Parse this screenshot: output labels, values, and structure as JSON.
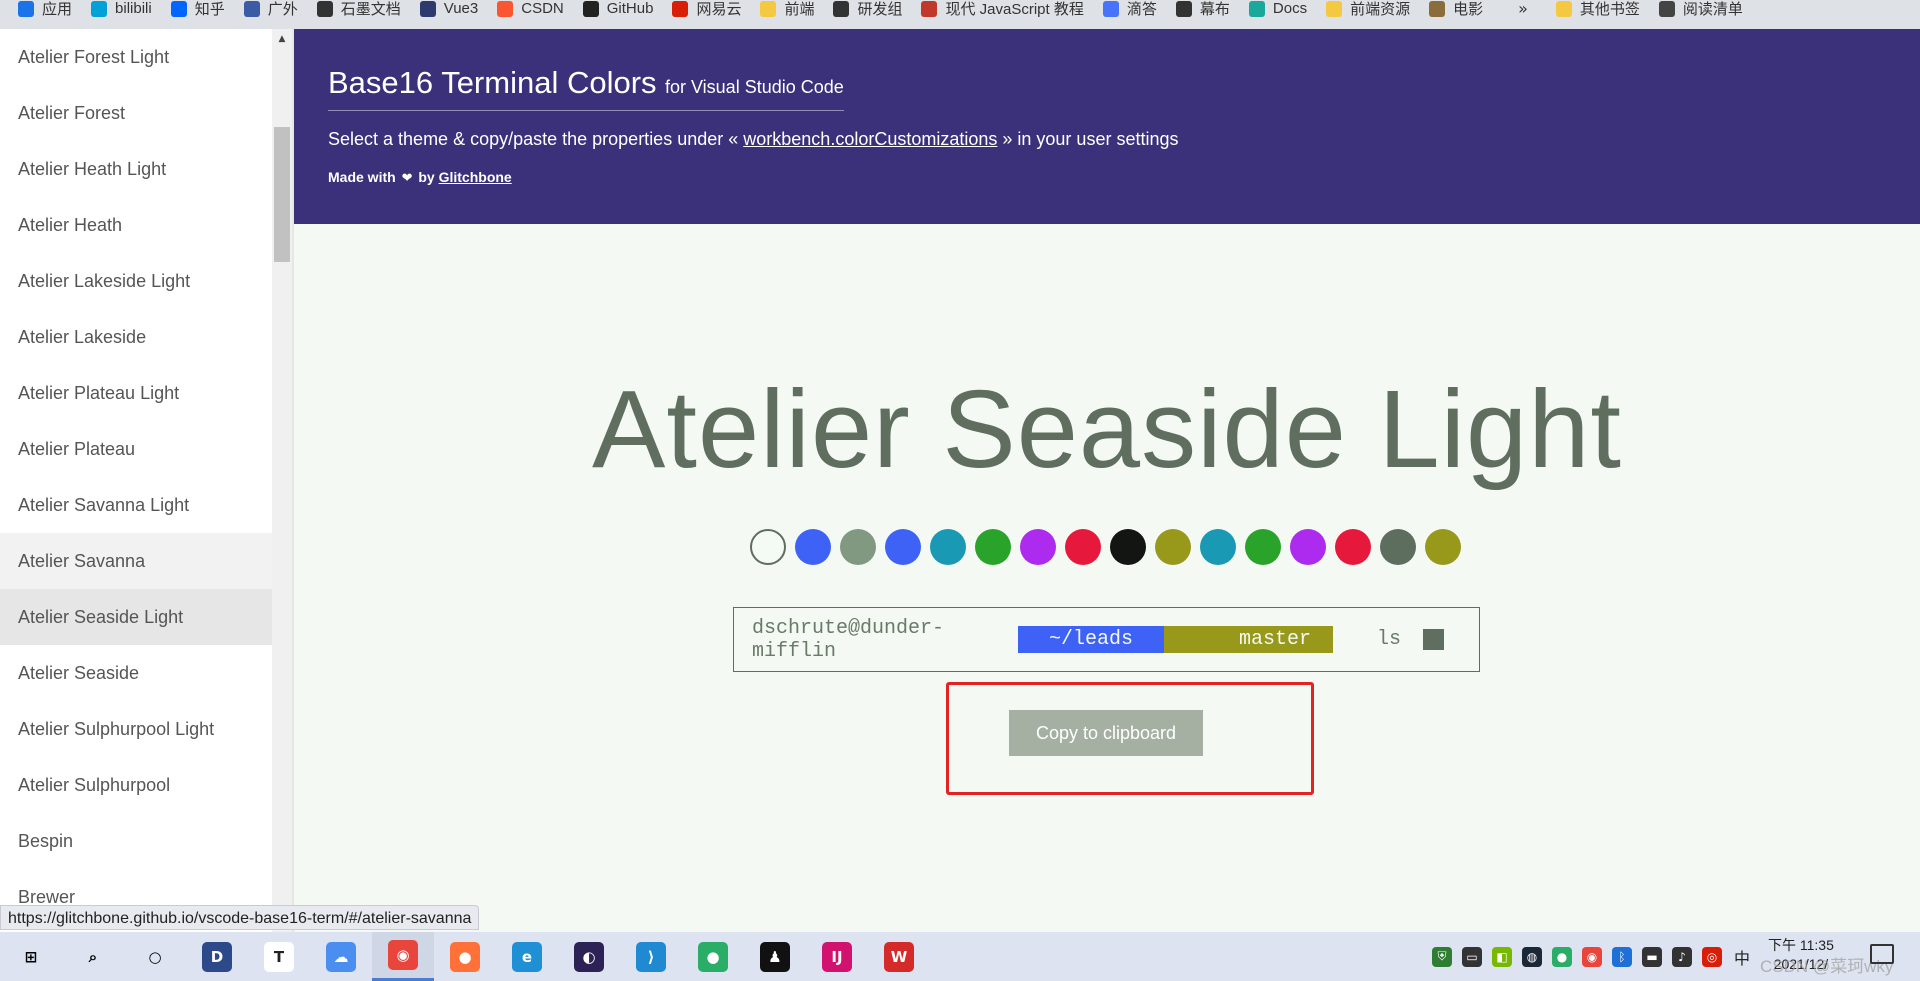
{
  "bookmarks": [
    {
      "label": "应用",
      "icon": "apps-grid-icon",
      "color": "#1a73e8"
    },
    {
      "label": "bilibili",
      "icon": "bilibili-icon",
      "color": "#00a1d6"
    },
    {
      "label": "知乎",
      "icon": "zhihu-icon",
      "color": "#0066ff"
    },
    {
      "label": "广外",
      "icon": "university-icon",
      "color": "#3b5ba5"
    },
    {
      "label": "石墨文档",
      "icon": "shimo-icon",
      "color": "#333333"
    },
    {
      "label": "Vue3",
      "icon": "globe-icon",
      "color": "#2d3a6e"
    },
    {
      "label": "CSDN",
      "icon": "csdn-icon",
      "color": "#fc5531"
    },
    {
      "label": "GitHub",
      "icon": "github-icon",
      "color": "#222222"
    },
    {
      "label": "网易云",
      "icon": "netease-icon",
      "color": "#d81e06"
    },
    {
      "label": "前端",
      "icon": "folder-icon",
      "color": "#f5c842"
    },
    {
      "label": "研发组",
      "icon": "team-icon",
      "color": "#333333"
    },
    {
      "label": "现代 JavaScript 教程",
      "icon": "js-tutorial-icon",
      "color": "#c0392b"
    },
    {
      "label": "滴答",
      "icon": "dida-icon",
      "color": "#4772fa"
    },
    {
      "label": "幕布",
      "icon": "mubu-icon",
      "color": "#333333"
    },
    {
      "label": "Docs",
      "icon": "docs-icon",
      "color": "#1aa89a"
    },
    {
      "label": "前端资源",
      "icon": "folder-icon",
      "color": "#f5c842"
    },
    {
      "label": "电影",
      "icon": "movie-icon",
      "color": "#8a6d3b"
    }
  ],
  "bookmarks_more": "»",
  "bookmarks_other": {
    "label": "其他书签",
    "icon": "folder-icon",
    "color": "#f5c842"
  },
  "reading_list": {
    "label": "阅读清单",
    "icon": "reading-list-icon",
    "color": "#444444"
  },
  "sidebar": {
    "items": [
      {
        "label": "Atelier Forest Light",
        "state": ""
      },
      {
        "label": "Atelier Forest",
        "state": ""
      },
      {
        "label": "Atelier Heath Light",
        "state": ""
      },
      {
        "label": "Atelier Heath",
        "state": ""
      },
      {
        "label": "Atelier Lakeside Light",
        "state": ""
      },
      {
        "label": "Atelier Lakeside",
        "state": ""
      },
      {
        "label": "Atelier Plateau Light",
        "state": ""
      },
      {
        "label": "Atelier Plateau",
        "state": ""
      },
      {
        "label": "Atelier Savanna Light",
        "state": ""
      },
      {
        "label": "Atelier Savanna",
        "state": "hover"
      },
      {
        "label": "Atelier Seaside Light",
        "state": "active"
      },
      {
        "label": "Atelier Seaside",
        "state": ""
      },
      {
        "label": "Atelier Sulphurpool Light",
        "state": ""
      },
      {
        "label": "Atelier Sulphurpool",
        "state": ""
      },
      {
        "label": "Bespin",
        "state": ""
      },
      {
        "label": "Brewer",
        "state": ""
      }
    ]
  },
  "header": {
    "title": "Base16 Terminal Colors",
    "subtitle": "for Visual Studio Code",
    "intro_before": "Select a theme & copy/paste the properties under «",
    "intro_link": "workbench.colorCustomizations",
    "intro_after": "» in your user settings",
    "credit_before": "Made with",
    "credit_by": "by",
    "credit_link": "Glitchbone"
  },
  "main": {
    "theme_name": "Atelier Seaside Light",
    "palette": [
      "#f4fbf4",
      "#3d62f5",
      "#809980",
      "#3d62f5",
      "#1999b3",
      "#29a329",
      "#ad2bee",
      "#e6193c",
      "#131513",
      "#98981b",
      "#1999b3",
      "#29a329",
      "#ad2bee",
      "#e6193c",
      "#5e6e5e",
      "#98981b"
    ],
    "terminal": {
      "user": "dschrute@dunder-mifflin",
      "path": "~/leads",
      "branch": "master",
      "command": "ls"
    },
    "copy_button": "Copy to clipboard"
  },
  "status_url": "https://glitchbone.github.io/vscode-base16-term/#/atelier-savanna",
  "taskbar": {
    "apps": [
      {
        "name": "windows-start-icon",
        "glyph": "⊞",
        "color": "transparent",
        "text": "#000000"
      },
      {
        "name": "search-icon",
        "glyph": "⌕",
        "color": "transparent",
        "text": "#000000"
      },
      {
        "name": "task-view-icon",
        "glyph": "○",
        "color": "transparent",
        "text": "#000000"
      },
      {
        "name": "devcpp-icon",
        "glyph": "D",
        "color": "#2c4a8a",
        "text": "#ffffff"
      },
      {
        "name": "typora-icon",
        "glyph": "T",
        "color": "#ffffff",
        "text": "#222222"
      },
      {
        "name": "baidu-netdisk-icon",
        "glyph": "☁",
        "color": "#4a8ff0",
        "text": "#ffffff"
      },
      {
        "name": "chrome-icon",
        "glyph": "◉",
        "color": "#e8453c",
        "text": "#ffffff",
        "active": true
      },
      {
        "name": "firefox-icon",
        "glyph": "●",
        "color": "#ff7139",
        "text": "#ffffff"
      },
      {
        "name": "edge-icon",
        "glyph": "e",
        "color": "#1f8fd6",
        "text": "#ffffff"
      },
      {
        "name": "eclipse-icon",
        "glyph": "◐",
        "color": "#2c2255",
        "text": "#ffffff"
      },
      {
        "name": "vscode-icon",
        "glyph": "⟩",
        "color": "#1f8ad2",
        "text": "#ffffff"
      },
      {
        "name": "wechat-icon",
        "glyph": "●",
        "color": "#2aae67",
        "text": "#ffffff"
      },
      {
        "name": "qq-icon",
        "glyph": "♟",
        "color": "#111111",
        "text": "#ffffff"
      },
      {
        "name": "intellij-icon",
        "glyph": "IJ",
        "color": "#d1126e",
        "text": "#ffffff"
      },
      {
        "name": "wps-icon",
        "glyph": "W",
        "color": "#d42a2a",
        "text": "#ffffff"
      }
    ],
    "tray": [
      {
        "name": "security-icon",
        "glyph": "⛨",
        "color": "#2e7d32"
      },
      {
        "name": "display-icon",
        "glyph": "▭",
        "color": "#333333"
      },
      {
        "name": "nvidia-icon",
        "glyph": "◧",
        "color": "#76b900"
      },
      {
        "name": "steam-icon",
        "glyph": "◍",
        "color": "#1b2838"
      },
      {
        "name": "wechat-tray-icon",
        "glyph": "●",
        "color": "#2aae67"
      },
      {
        "name": "chrome-tray-icon",
        "glyph": "◉",
        "color": "#e8453c"
      },
      {
        "name": "bluetooth-icon",
        "glyph": "ᛒ",
        "color": "#1e6fd6"
      },
      {
        "name": "battery-icon",
        "glyph": "▬",
        "color": "#333333"
      },
      {
        "name": "volume-icon",
        "glyph": "♪",
        "color": "#333333"
      },
      {
        "name": "netease-tray-icon",
        "glyph": "◎",
        "color": "#d81e06"
      },
      {
        "name": "input-method-icon",
        "glyph": "中",
        "color": "transparent"
      }
    ],
    "clock_time": "下午 11:35",
    "clock_date": "2021/12/",
    "watermark": "CSDN @菜珂wky"
  }
}
